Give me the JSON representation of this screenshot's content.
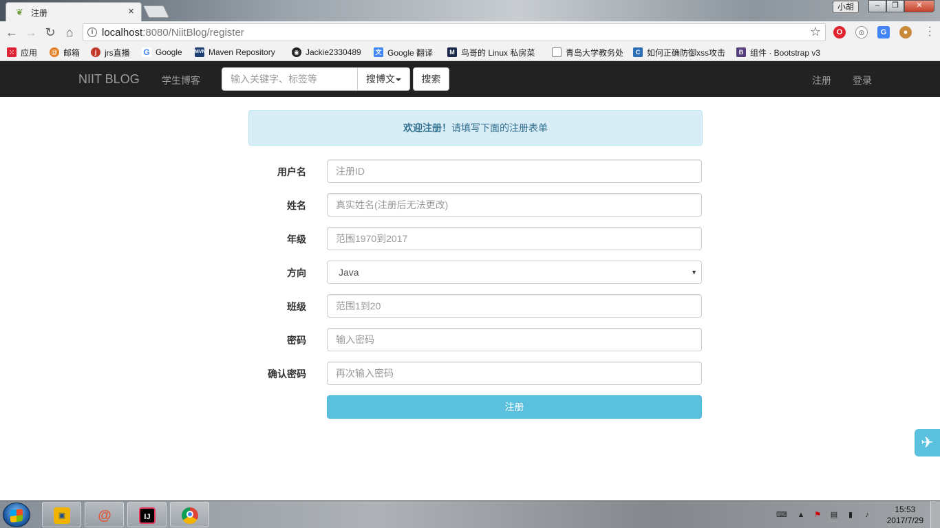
{
  "browser": {
    "tab_title": "注册",
    "tab_close": "×",
    "url_host": "localhost",
    "url_path": ":8080/NiitBlog/register",
    "profile_name": "小胡",
    "win_minimize": "–",
    "win_maximize": "❐",
    "win_close": "✕",
    "bookmarks": [
      {
        "label": "应用",
        "icon": "apps-grid-icon",
        "color": "#d23"
      },
      {
        "label": "邮箱",
        "icon": "mail-icon",
        "color": "#e67e22"
      },
      {
        "label": "jrs直播",
        "icon": "jrs-icon",
        "color": "#c0392b"
      },
      {
        "label": "Google",
        "icon": "google-icon",
        "color": "#4285f4"
      },
      {
        "label": "Maven Repository",
        "icon": "maven-icon",
        "color": "#1d3f73"
      },
      {
        "label": "Jackie2330489",
        "icon": "github-icon",
        "color": "#222"
      },
      {
        "label": "Google 翻译",
        "icon": "translate-icon",
        "color": "#4285f4"
      },
      {
        "label": "鸟哥的 Linux 私房菜",
        "icon": "linux-icon",
        "color": "#1b2a4a"
      },
      {
        "label": "青岛大学教务处",
        "icon": "page-icon",
        "color": "#888"
      },
      {
        "label": "如何正确防御xss攻击",
        "icon": "article-icon",
        "color": "#2c6fb7"
      },
      {
        "label": "组件 · Bootstrap v3",
        "icon": "bootstrap-icon",
        "color": "#563d7c"
      }
    ]
  },
  "navbar": {
    "brand": "NIIT BLOG",
    "student_blogs": "学生博客",
    "search_placeholder": "输入关键字、标签等",
    "search_type": "搜博文",
    "search_button": "搜索",
    "register": "注册",
    "login": "登录"
  },
  "alert": {
    "strong": "欢迎注册！",
    "text": "请填写下面的注册表单"
  },
  "form": {
    "fields": [
      {
        "label": "用户名",
        "placeholder": "注册ID"
      },
      {
        "label": "姓名",
        "placeholder": "真实姓名(注册后无法更改)"
      },
      {
        "label": "年级",
        "placeholder": "范围1970到2017"
      },
      {
        "label": "方向",
        "value": "Java"
      },
      {
        "label": "班级",
        "placeholder": "范围1到20"
      },
      {
        "label": "密码",
        "placeholder": "输入密码"
      },
      {
        "label": "确认密码",
        "placeholder": "再次输入密码"
      }
    ],
    "submit": "注册"
  },
  "taskbar": {
    "apps": [
      {
        "name": "file-manager",
        "color": "#f0b400",
        "glyph": "▣"
      },
      {
        "name": "snail",
        "color": "#e0573a",
        "glyph": "@"
      },
      {
        "name": "intellij",
        "color": "#000",
        "glyph": "IJ"
      },
      {
        "name": "chrome",
        "color": "#1a73e8",
        "glyph": "◉"
      }
    ],
    "time": "15:53",
    "date": "2017/7/29"
  }
}
